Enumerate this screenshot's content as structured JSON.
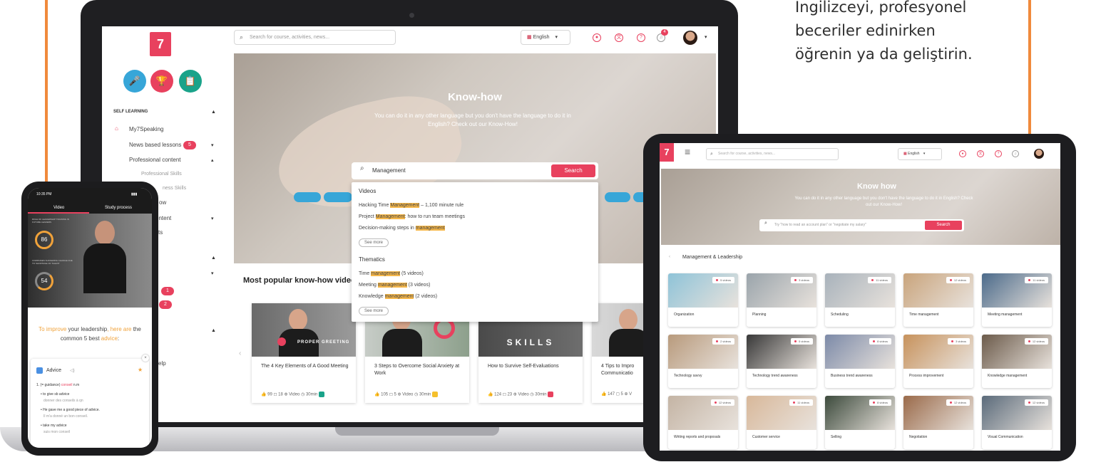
{
  "promo": {
    "lines": [
      "İngilizceyi, profesyonel",
      "beceriler edinirken",
      "öğrenin ya da geliştirin."
    ]
  },
  "laptop": {
    "logo": "7",
    "badges": [
      "🎤",
      "🏆",
      "📋"
    ],
    "sidebar": {
      "heading": "SELF LEARNING",
      "items": [
        {
          "label": "My7Speaking"
        },
        {
          "label": "News based lessons",
          "count": "5"
        },
        {
          "label": "Professional content"
        },
        {
          "label": "Professional Skills"
        },
        {
          "label": "ness Skills"
        },
        {
          "label": "ow"
        },
        {
          "label": "ontent"
        },
        {
          "label": "sts"
        },
        {
          "label": "elp"
        }
      ],
      "counts": [
        "1",
        "2"
      ]
    },
    "search_placeholder": "Search for course, activities, news...",
    "language": "English",
    "notification_count": "4",
    "hero": {
      "title": "Know-how",
      "subtitle": "You can do it in any other language but you don't have the language to do it in English? Check out our Know-How!",
      "search_value": "Management",
      "search_button": "Search",
      "chips": [
        "",
        "",
        "",
        ""
      ]
    },
    "dropdown": {
      "videos_heading": "Videos",
      "videos": [
        {
          "pre": "Hacking Time ",
          "hl": "Management",
          "post": " – 1,100 minute rule"
        },
        {
          "pre": "Project ",
          "hl": "Management",
          "post": ": how to run team meetings"
        },
        {
          "pre": "Decision-making steps in ",
          "hl": "management",
          "post": ""
        }
      ],
      "see_more": "See more",
      "thematics_heading": "Thematics",
      "thematics": [
        {
          "pre": "Time ",
          "hl": "management",
          "post": " (5 videos)"
        },
        {
          "pre": "Meeting ",
          "hl": "management",
          "post": " (3 videos)"
        },
        {
          "pre": "Knowledge ",
          "hl": "management",
          "post": " (2 videos)"
        }
      ]
    },
    "popular_heading": "Most popular know-how videos",
    "cards": [
      {
        "thumb_text": "PROPER GREETING",
        "title": "The 4 Key Elements of A Good Meeting",
        "meta": "👍 99  ◻ 18  ⊕ Video  ◷ 30min",
        "color": "#1aa38a"
      },
      {
        "thumb_text": "",
        "title": "3 Steps to Overcome Social Anxiety at Work",
        "meta": "👍 105  ◻ 5  ⊕ Video  ◷ 30min",
        "color": "#f5c02c"
      },
      {
        "thumb_text": "SKILLS",
        "title": "How to Survive Self-Evaluations",
        "meta": "👍 124  ◻ 23  ⊕ Video  ◷ 30min",
        "color": "#e8415e"
      },
      {
        "thumb_text": "",
        "title": "4 Tips to Impro Communicatio",
        "meta": "👍 147  ◻ 5  ⊕ V",
        "color": "#1aa38a"
      }
    ]
  },
  "tablet": {
    "logo": "7",
    "search_placeholder": "Search for course, activities, news...",
    "language": "English",
    "hero": {
      "title": "Know how",
      "subtitle": "You can do it in any other language but you don't have the language to do it in English? Check out our Know-How!",
      "search_placeholder": "Try \"how to read an account plan\" or \"negotiate my salary\"",
      "search_button": "Search"
    },
    "section": "Management & Leadership",
    "tiles": [
      {
        "label": "Organization",
        "count": "5 videos",
        "color": "#8ec3d8"
      },
      {
        "label": "Planning",
        "count": "3 videos",
        "color": "#9aa4ab"
      },
      {
        "label": "Scheduling",
        "count": "11 videos",
        "color": "#a8b2bb"
      },
      {
        "label": "Time management",
        "count": "12 videos",
        "color": "#c9a47c"
      },
      {
        "label": "Meeting management",
        "count": "11 videos",
        "color": "#4b6a8a"
      },
      {
        "label": "Technology savvy",
        "count": "2 videos",
        "color": "#b89a7c"
      },
      {
        "label": "Technology trend awareness",
        "count": "5 videos",
        "color": "#383838"
      },
      {
        "label": "Business trend awareness",
        "count": "8 videos",
        "color": "#7c8aa8"
      },
      {
        "label": "Process improvement",
        "count": "3 videos",
        "color": "#c7925c"
      },
      {
        "label": "Knowledge management",
        "count": "12 videos",
        "color": "#6b5a4a"
      },
      {
        "label": "Writing reports and proposals",
        "count": "12 videos",
        "color": "#c4b4a4"
      },
      {
        "label": "Customer service",
        "count": "11 videos",
        "color": "#d8b89a"
      },
      {
        "label": "Selling",
        "count": "8 videos",
        "color": "#3c4a3c"
      },
      {
        "label": "Negotiation",
        "count": "12 videos",
        "color": "#9a6a4a"
      },
      {
        "label": "Visual Communication",
        "count": "12 videos",
        "color": "#5a6a7a"
      }
    ]
  },
  "phone": {
    "time": "10:35 PM",
    "tabs": [
      "Video",
      "Study process"
    ],
    "scores": [
      "86",
      "54"
    ],
    "video_text_top": "ROLE OF LEADERSHIP TRAINING IN FUTURE LEADERS",
    "video_text_bottom": "COMPANIES SUFFERING CHANGE DUE TO SHORTAGE OF TALENT",
    "time_start": "02:08",
    "time_end": "05:12",
    "tip": {
      "a": "To improve ",
      "b": "your leadership",
      "c": ", ",
      "d": "here are",
      "e": " the common 5 best ",
      "f": "advice",
      "g": ":"
    },
    "card": {
      "title": "Advice",
      "lines": [
        {
          "text": "1. (= guidance)  ",
          "red": "conseil",
          "tail": " n.m"
        },
        {
          "text": "• to give sb advice",
          "sub": "donner des conseils à qn"
        },
        {
          "text": "• He gave me a good piece of advice.",
          "sub": "Il m'a donné un bon conseil."
        },
        {
          "text": "• take my advice",
          "sub": "suis mon conseil"
        }
      ]
    }
  }
}
